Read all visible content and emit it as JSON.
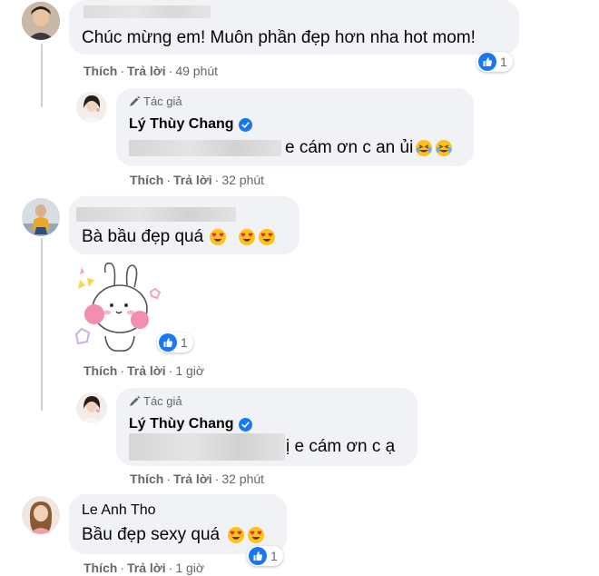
{
  "comments": [
    {
      "text": "Chúc mừng em! Muôn phần đẹp hơn nha hot mom!",
      "like": "Thích",
      "reply": "Trả lời",
      "time": "49 phút",
      "reaction_count": "1"
    },
    {
      "author_badge": "Tác giả",
      "name": "Lý Thùy Chang",
      "text": "e cám ơn c an ủi",
      "like": "Thích",
      "reply": "Trả lời",
      "time": "32 phút"
    },
    {
      "text": "Bà bầu đẹp quá",
      "like": "Thích",
      "reply": "Trả lời",
      "time": "1 giờ",
      "reaction_count": "1"
    },
    {
      "author_badge": "Tác giả",
      "name": "Lý Thùy Chang",
      "text": "ị e cám ơn c ạ",
      "like": "Thích",
      "reply": "Trả lời",
      "time": "32 phút"
    },
    {
      "name": "Le Anh Tho",
      "text": "Bầu đẹp sexy quá",
      "like": "Thích",
      "reply": "Trả lời",
      "time": "1 giờ",
      "reaction_count": "1"
    }
  ],
  "icons": {
    "like_reaction": "like-icon",
    "verified": "verified-badge-icon",
    "author": "pencil-icon",
    "emoji": [
      "heart-eyes-emoji",
      "laughing-tears-emoji"
    ],
    "sticker": "bunny-sticker"
  },
  "colors": {
    "bubble": "#f0f2f5",
    "meta": "#65676b",
    "like_blue": "#1877f2"
  }
}
